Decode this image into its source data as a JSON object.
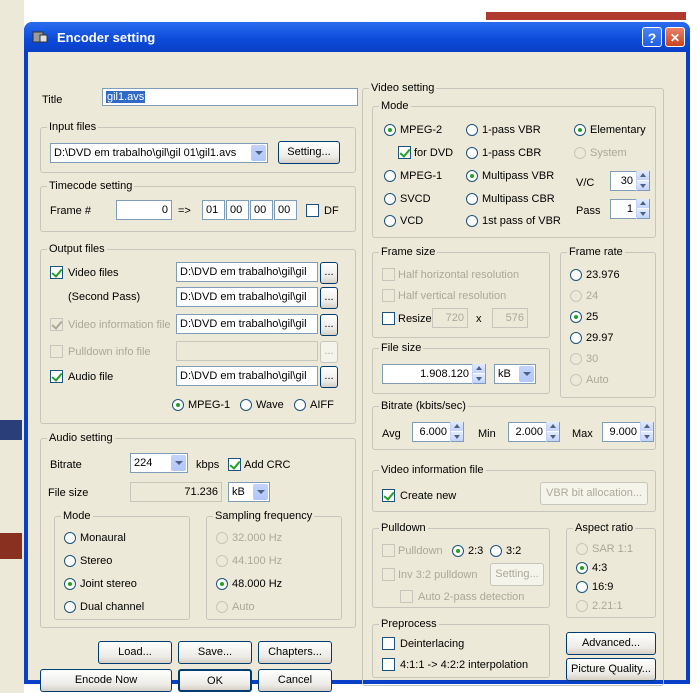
{
  "window": {
    "title": "Encoder setting",
    "help_glyph": "?",
    "close_glyph": "✕"
  },
  "title_field": {
    "label": "Title",
    "value": "gil1.avs"
  },
  "input_files": {
    "legend": "Input files",
    "path": "D:\\DVD em trabalho\\gil\\gil 01\\gil1.avs",
    "setting_label": "Setting..."
  },
  "timecode": {
    "legend": "Timecode setting",
    "frame_label": "Frame #",
    "frame_value": "0",
    "arrow": "=>",
    "hh": "01",
    "mm": "00",
    "ss": "00",
    "ff": "00",
    "df_label": "DF"
  },
  "output_files": {
    "legend": "Output files",
    "video_label": "Video files",
    "video_path": "D:\\DVD em trabalho\\gil\\gil",
    "second_pass_label": "(Second Pass)",
    "second_pass_path": "D:\\DVD em trabalho\\gil\\gil",
    "vinfo_label": "Video information file",
    "vinfo_path": "D:\\DVD em trabalho\\gil\\gil",
    "pulldown_label": "Pulldown info file",
    "pulldown_path": "",
    "audio_label": "Audio file",
    "audio_path": "D:\\DVD em trabalho\\gil\\gil",
    "browse": "...",
    "fmt_mpeg1": "MPEG-1",
    "fmt_wave": "Wave",
    "fmt_aiff": "AIFF"
  },
  "audio": {
    "legend": "Audio setting",
    "bitrate_label": "Bitrate",
    "bitrate_value": "224",
    "kbps": "kbps",
    "crc_label": "Add CRC",
    "filesize_label": "File size",
    "filesize_value": "71.236",
    "filesize_unit": "kB",
    "mode_legend": "Mode",
    "mode_monaural": "Monaural",
    "mode_stereo": "Stereo",
    "mode_joint": "Joint stereo",
    "mode_dual": "Dual channel",
    "freq_legend": "Sampling frequency",
    "freq_32": "32.000 Hz",
    "freq_44": "44.100 Hz",
    "freq_48": "48.000 Hz",
    "freq_auto": "Auto"
  },
  "buttons": {
    "load": "Load...",
    "save": "Save...",
    "chapters": "Chapters...",
    "encode": "Encode Now",
    "ok": "OK",
    "cancel": "Cancel",
    "advanced": "Advanced...",
    "quality": "Picture Quality..."
  },
  "video": {
    "legend": "Video setting",
    "mode_legend": "Mode",
    "mpeg2": "MPEG-2",
    "for_dvd": "for DVD",
    "mpeg1": "MPEG-1",
    "svcd": "SVCD",
    "vcd": "VCD",
    "vbr1": "1-pass VBR",
    "cbr1": "1-pass CBR",
    "mvbr": "Multipass VBR",
    "mcbr": "Multipass CBR",
    "first_vbr": "1st pass of VBR",
    "elementary": "Elementary",
    "system": "System",
    "vc_label": "V/C",
    "vc_value": "30",
    "pass_label": "Pass",
    "pass_value": "1"
  },
  "frame_size": {
    "legend": "Frame size",
    "half_h": "Half horizontal resolution",
    "half_v": "Half vertical resolution",
    "resize": "Resize",
    "w": "720",
    "x": "x",
    "h": "576"
  },
  "file_size": {
    "legend": "File size",
    "value": "1.908.120",
    "unit": "kB"
  },
  "frame_rate": {
    "legend": "Frame rate",
    "r23": "23.976",
    "r24": "24",
    "r25": "25",
    "r2997": "29.97",
    "r30": "30",
    "auto": "Auto"
  },
  "bitrate": {
    "legend": "Bitrate (kbits/sec)",
    "avg_label": "Avg",
    "avg": "6.000",
    "min_label": "Min",
    "min": "2.000",
    "max_label": "Max",
    "max": "9.000"
  },
  "vinfo": {
    "legend": "Video information file",
    "create_new": "Create new",
    "vbr_alloc": "VBR bit allocation..."
  },
  "pulldown": {
    "legend": "Pulldown",
    "pulldown_label": "Pulldown",
    "r23": "2:3",
    "r32": "3:2",
    "inv": "Inv 3:2 pulldown",
    "setting": "Setting...",
    "auto2": "Auto 2-pass detection"
  },
  "aspect": {
    "legend": "Aspect ratio",
    "sar": "SAR 1:1",
    "a43": "4:3",
    "a169": "16:9",
    "a221": "2.21:1"
  },
  "preprocess": {
    "legend": "Preprocess",
    "deint": "Deinterlacing",
    "interp": "4:1:1 -> 4:2:2 interpolation"
  }
}
